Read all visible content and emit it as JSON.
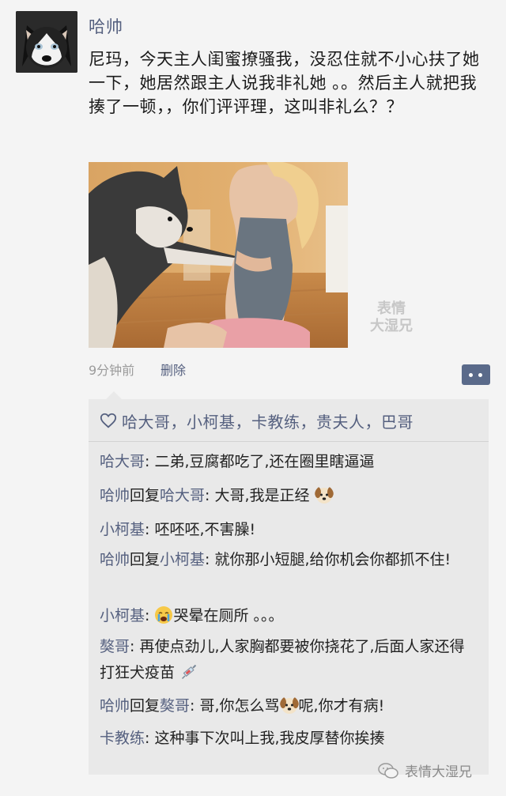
{
  "post": {
    "author": "哈帅",
    "text": "尼玛，今天主人闺蜜撩骚我，没忍住就不小心扶了她一下，她居然跟主人说我非礼她 。。然后主人就把我揍了一顿，，你们评评理，这叫非礼么？？",
    "time": "9分钟前",
    "delete_label": "删除",
    "image_watermark": "表情\n大湿兄"
  },
  "likes": {
    "names": "哈大哥，小柯基，卡教练，贵夫人，巴哥"
  },
  "comments": [
    {
      "name": "哈大哥",
      "text": ": 二弟,豆腐都吃了,还在圈里瞎逼逼"
    },
    {
      "name": "哈帅",
      "reply_word": "回复",
      "reply_to": "哈大哥",
      "text": ": 大哥,我是正经",
      "emoji_after": "dog-face-emoji"
    },
    {
      "name": "小柯基",
      "text": ": 呸呸呸,不害臊!"
    },
    {
      "name": "哈帅",
      "reply_word": "回复",
      "reply_to": "小柯基",
      "text": ": 就你那小短腿,给你机会你都抓不住!"
    },
    {
      "name": "小柯基",
      "emoji_before": "crying-face-emoji",
      "text": "哭晕在厕所 。。。"
    },
    {
      "name": "獒哥",
      "text": ": 再使点劲儿,人家胸都要被你挠花了,后面人家还得打狂犬疫苗",
      "emoji_after": "syringe-emoji"
    },
    {
      "name": "哈帅",
      "reply_word": "回复",
      "reply_to": "獒哥",
      "text_before": ": 哥,你怎么骂",
      "emoji_mid": "dog-face-emoji",
      "text_after": "呢,你才有病!"
    },
    {
      "name": "卡教练",
      "text": ": 这种事下次叫上我,我皮厚替你挨揍"
    }
  ],
  "footer": {
    "watermark": "表情大湿兄"
  },
  "colors": {
    "name_blue": "#55607f",
    "background": "#f4f4f4",
    "comment_bg": "#e9e9e9"
  }
}
